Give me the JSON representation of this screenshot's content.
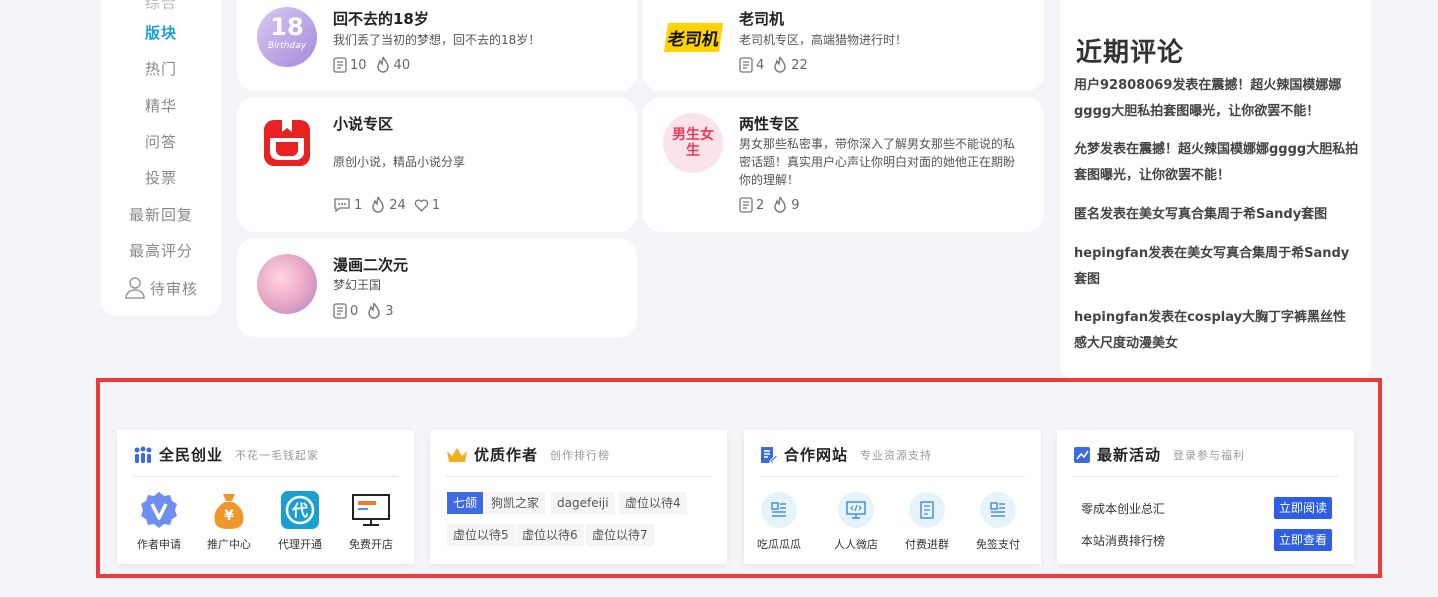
{
  "nav": {
    "items": [
      {
        "label": "版块",
        "active": true
      },
      {
        "label": "热门"
      },
      {
        "label": "精华"
      },
      {
        "label": "问答"
      },
      {
        "label": "投票"
      },
      {
        "label": "最新回复"
      },
      {
        "label": "最高评分"
      },
      {
        "label": "待审核"
      }
    ],
    "top_partial": "综合"
  },
  "forums": [
    {
      "title": "回不去的18岁",
      "desc": "我们丢了当初的梦想，回不去的18岁！",
      "posts": "10",
      "heat": "40",
      "avatar_text": "18",
      "avatar_sub": "Birthday"
    },
    {
      "title": "老司机",
      "desc": "老司机专区，高端猎物进行时！",
      "posts": "4",
      "heat": "22",
      "avatar_text": "老司机"
    },
    {
      "title": "小说专区",
      "desc": "原创小说，精品小说分享",
      "comments": "1",
      "heat": "24",
      "likes": "1"
    },
    {
      "title": "两性专区",
      "desc": "男女那些私密事，带你深入了解男女那些不能说的私密话题！真实用户心声让你明白对面的她他正在期盼你的理解！",
      "posts": "2",
      "heat": "9",
      "avatar_text": "男生女生"
    },
    {
      "title": "漫画二次元",
      "desc": "梦幻王国",
      "posts": "0",
      "heat": "3"
    }
  ],
  "comments": {
    "title": "近期评论",
    "items": [
      "用户92808069发表在震撼！超火辣国模娜娜gggg大胆私拍套图曝光，让你欲罢不能！",
      "允梦发表在震撼！超火辣国模娜娜gggg大胆私拍套图曝光，让你欲罢不能！",
      "匿名发表在美女写真合集周于希Sandy套图",
      "hepingfan发表在美女写真合集周于希Sandy套图",
      "hepingfan发表在cosplay大胸丁字裤黑丝性感大尺度动漫美女"
    ]
  },
  "promo": {
    "startup": {
      "title": "全民创业",
      "subtitle": "不花一毛钱起家",
      "tiles": [
        "作者申请",
        "推广中心",
        "代理开通",
        "免费开店"
      ]
    },
    "authors": {
      "title": "优质作者",
      "subtitle": "创作排行榜",
      "tags": [
        "七颌",
        "狗凯之家",
        "dagefeiji",
        "虚位以待4",
        "虚位以待5",
        "虚位以待6",
        "虚位以待7"
      ]
    },
    "partners": {
      "title": "合作网站",
      "subtitle": "专业资源支持",
      "tiles": [
        "吃瓜瓜瓜",
        "人人微店",
        "付费进群",
        "免签支付"
      ]
    },
    "events": {
      "title": "最新活动",
      "subtitle": "登录参与福利",
      "items": [
        {
          "text": "零成本创业总汇",
          "button": "立即阅读"
        },
        {
          "text": "本站消费排行榜",
          "button": "立即查看"
        }
      ]
    }
  },
  "colors": {
    "accent": "#1aa1d8",
    "frame": "#ee3a3a",
    "button": "#2e5ee8"
  }
}
